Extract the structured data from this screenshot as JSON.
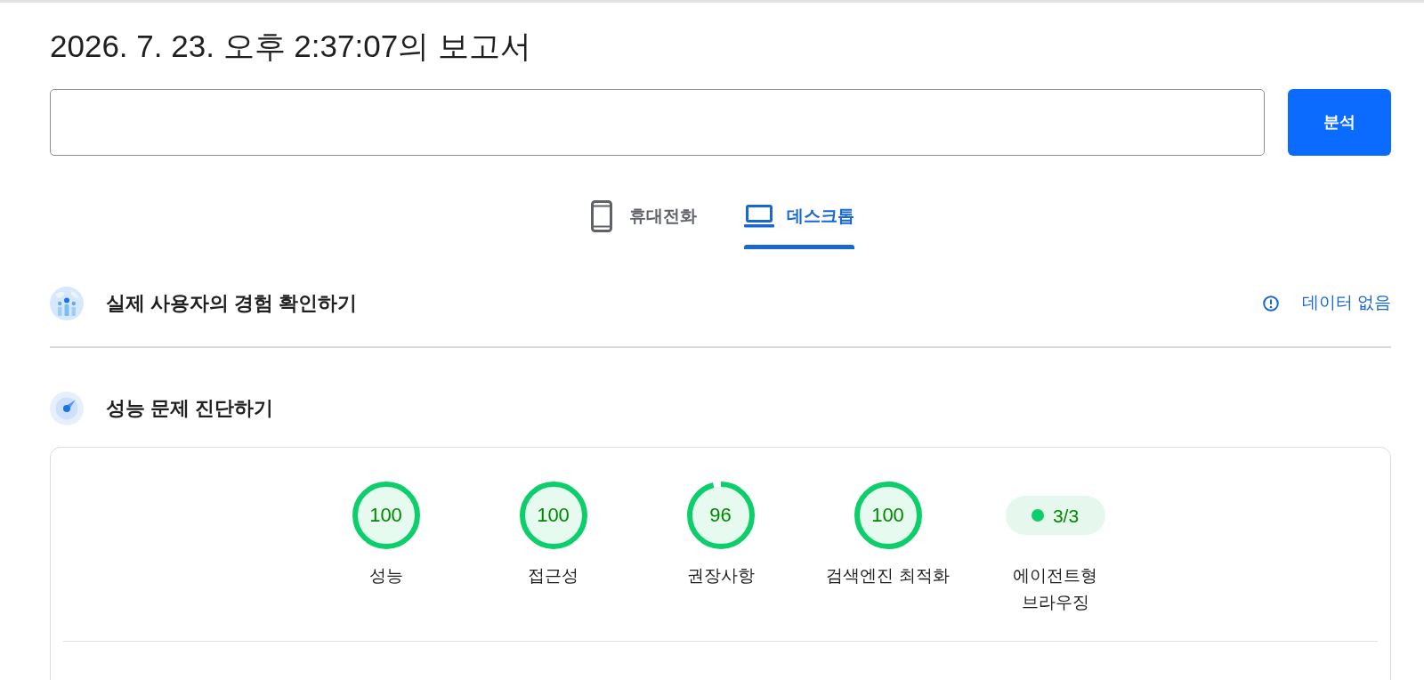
{
  "report_title": "2026. 7. 23. 오후 2:37:07의 보고서",
  "analyze_button": {
    "label": "분석"
  },
  "device_tabs": [
    {
      "label": "휴대전화",
      "selected": false
    },
    {
      "label": "데스크톱",
      "selected": true
    }
  ],
  "sections": [
    {
      "title": "실제 사용자의 경험 확인하기",
      "status": "데이터 없음"
    },
    {
      "title": "성능 문제 진단하기",
      "scores": [
        {
          "kind": "gauge",
          "score": "100",
          "level": 1,
          "label": "성능"
        },
        {
          "kind": "gauge",
          "score": "100",
          "level": 1,
          "label": "접근성"
        },
        {
          "kind": "gauge",
          "score": "96",
          "level": 0.96,
          "label": "권장사항"
        },
        {
          "kind": "gauge",
          "score": "100",
          "level": 1,
          "label": "검색엔진 최적화"
        },
        {
          "kind": "fraction",
          "score": "3/3",
          "label": "에이전트형 브라우징"
        }
      ]
    }
  ]
}
